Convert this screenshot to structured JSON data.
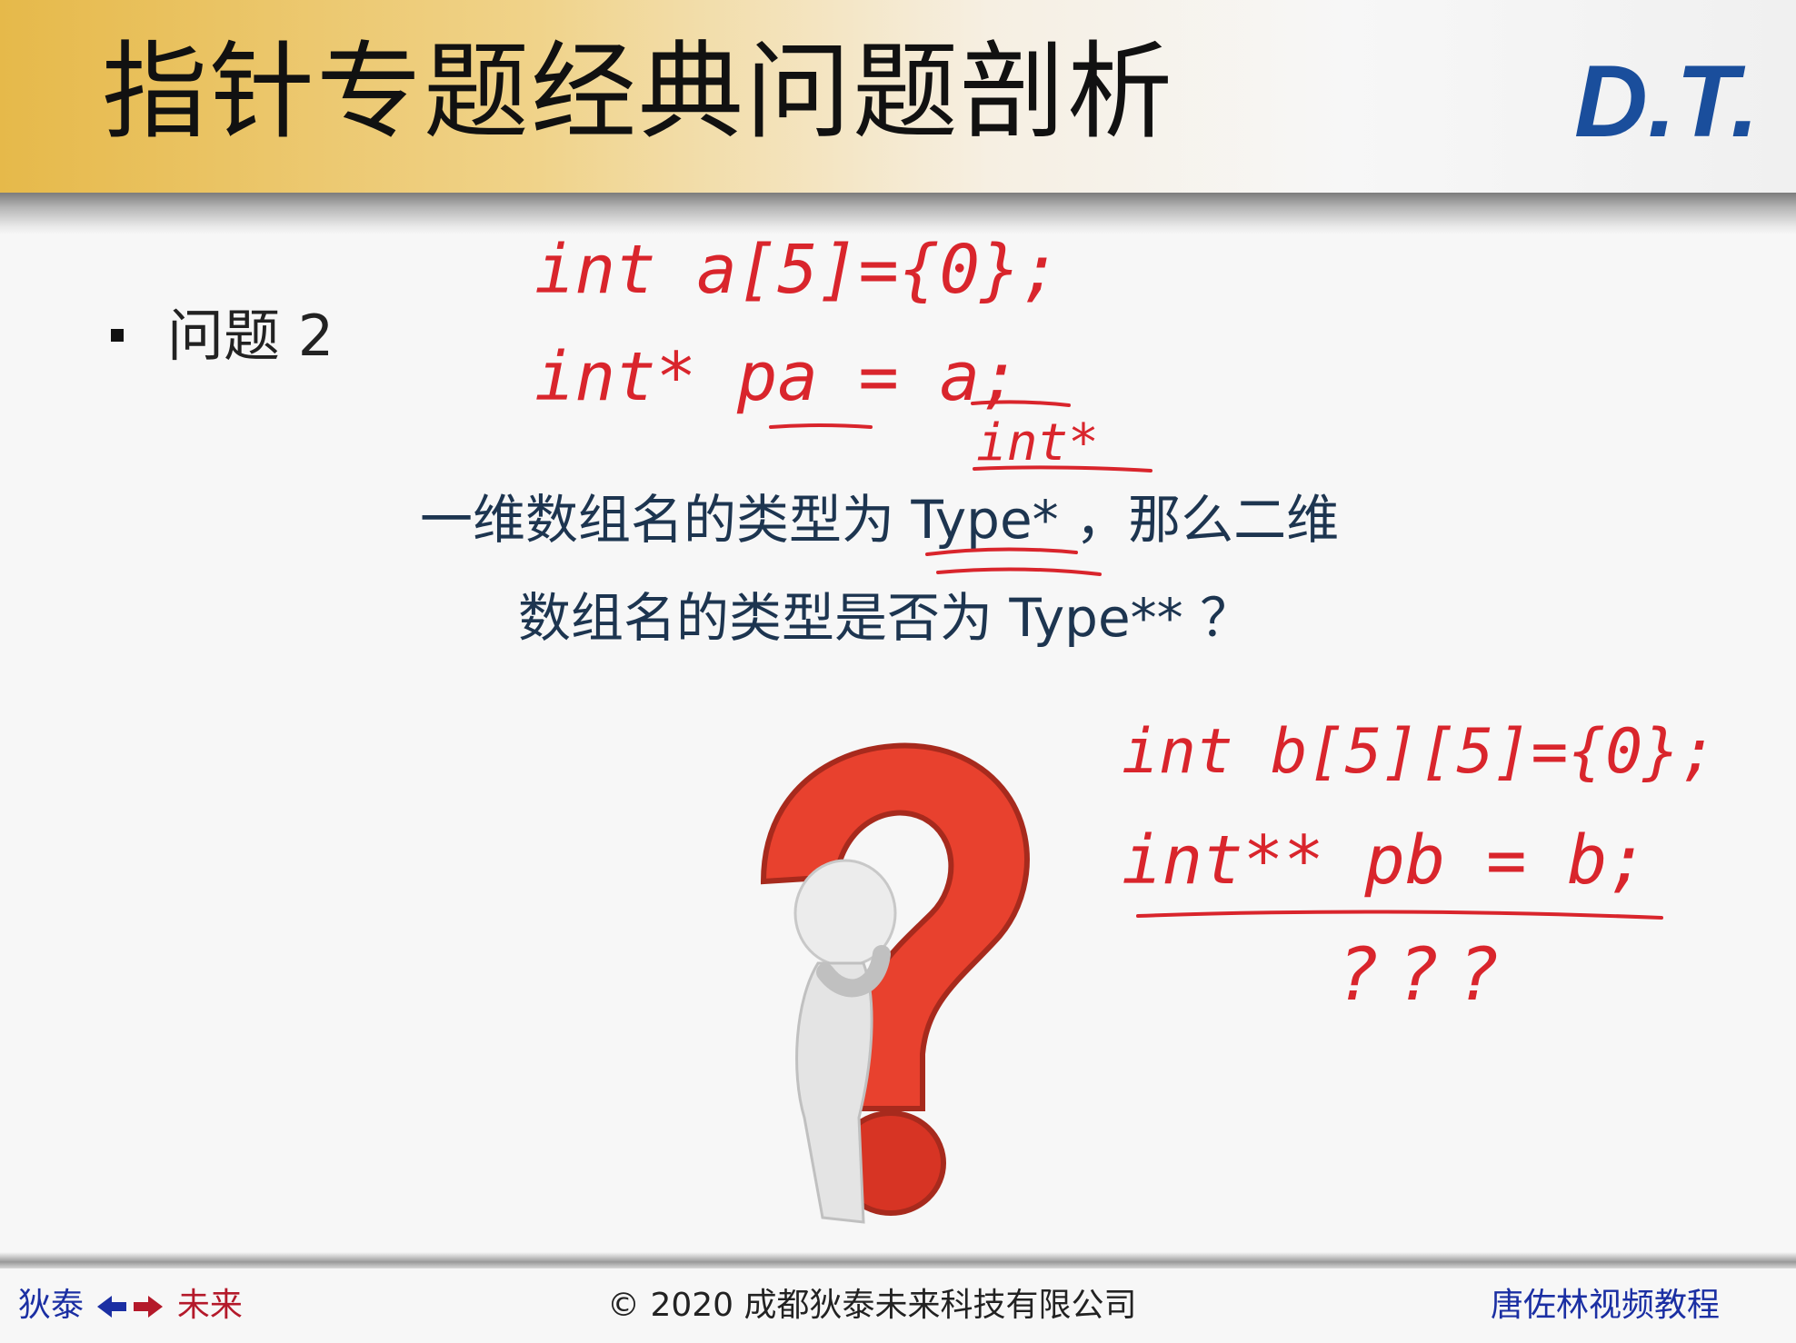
{
  "slide": {
    "title": "指针专题经典问题剖析",
    "logo_text": "D.T.",
    "bullet": "问题 2",
    "question_line1": "一维数组名的类型为 Type* ，那么二维",
    "question_line2": "数组名的类型是否为 Type** ？"
  },
  "handwriting": {
    "line1": "int a[5]={0};",
    "line2_prefix": "int* ",
    "line2_var": "pa",
    "line2_suffix": " = a;",
    "type_note": "int*",
    "line3": "int b[5][5]={0};",
    "line4": "int** pb = b;",
    "mark": "???"
  },
  "footer": {
    "left_a": "狄泰",
    "left_b": "未来",
    "center": "© 2020 成都狄泰未来科技有限公司",
    "right": "唐佐林视频教程"
  },
  "colors": {
    "header_gold": "#e6b94a",
    "ink_red": "#d9252c",
    "logo_blue": "#1a4e9c",
    "logo_red": "#c9262d",
    "text_navy": "#1d3550"
  }
}
